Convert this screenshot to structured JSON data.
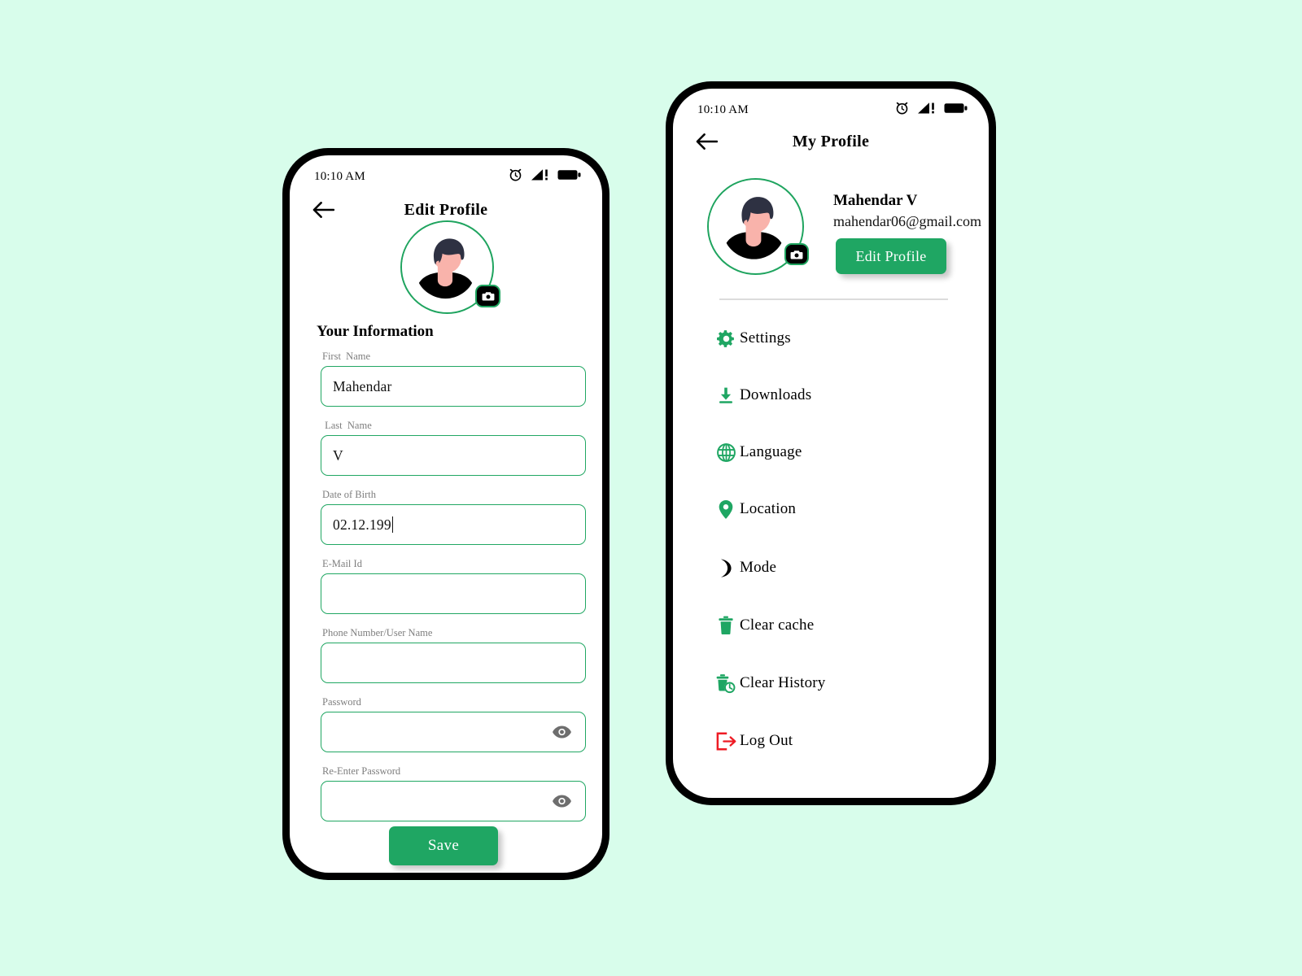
{
  "colors": {
    "page_background": "#d8fdeb",
    "accent_green": "#1fa663",
    "border_green": "#21a763",
    "logout_red": "#ee1b24",
    "label_gray": "#7e7e7e",
    "avatar_hair": "#2e3142",
    "avatar_skin": "#f9b3ab",
    "avatar_shirt": "#000000"
  },
  "edit_profile_screen": {
    "status_bar": {
      "time": "10:10 AM",
      "icons": [
        "alarm-icon",
        "signal-icon",
        "battery-icon"
      ]
    },
    "app_bar": {
      "back_icon": "arrow-left-icon",
      "title": "Edit Profile"
    },
    "avatar": {
      "name": "user-avatar",
      "camera_badge_icon": "camera-icon"
    },
    "section_title": "Your Information",
    "fields": [
      {
        "label": "First  Name",
        "value": "Mahendar",
        "placeholder": "",
        "type": "text",
        "caret": false,
        "eye": false
      },
      {
        "label": " Last  Name",
        "value": "V",
        "placeholder": "",
        "type": "text",
        "caret": false,
        "eye": false
      },
      {
        "label": "Date of Birth",
        "value": "02.12.199",
        "placeholder": "",
        "type": "text",
        "caret": true,
        "eye": false
      },
      {
        "label": "E-Mail Id",
        "value": "",
        "placeholder": "",
        "type": "email",
        "caret": false,
        "eye": false
      },
      {
        "label": "Phone Number/User Name",
        "value": "",
        "placeholder": "",
        "type": "text",
        "caret": false,
        "eye": false
      },
      {
        "label": "Password",
        "value": "",
        "placeholder": "",
        "type": "password",
        "caret": false,
        "eye": true
      },
      {
        "label": "Re-Enter Password",
        "value": "",
        "placeholder": "",
        "type": "password",
        "caret": false,
        "eye": true
      }
    ],
    "save_button": "Save"
  },
  "my_profile_screen": {
    "status_bar": {
      "time": "10:10 AM",
      "icons": [
        "alarm-icon",
        "signal-icon",
        "battery-icon"
      ]
    },
    "app_bar": {
      "back_icon": "arrow-left-icon",
      "title": "My Profile"
    },
    "avatar": {
      "name": "user-avatar",
      "camera_badge_icon": "camera-icon"
    },
    "user": {
      "name": "Mahendar V",
      "email": "mahendar06@gmail.com"
    },
    "edit_profile_button": "Edit Profile",
    "menu": [
      {
        "label": "Settings",
        "icon": "gear-icon",
        "color": "#1fa663"
      },
      {
        "label": "Downloads",
        "icon": "download-icon",
        "color": "#1fa663"
      },
      {
        "label": "Language",
        "icon": "globe-icon",
        "color": "#1fa663"
      },
      {
        "label": "Location",
        "icon": "location-pin-icon",
        "color": "#1fa663"
      },
      {
        "label": " Mode",
        "icon": "moon-icon",
        "color": "#000000"
      },
      {
        "label": "Clear cache",
        "icon": "trash-icon",
        "color": "#1fa663"
      },
      {
        "label": " Clear History",
        "icon": "trash-clock-icon",
        "color": "#1fa663"
      },
      {
        "label": "Log Out",
        "icon": "logout-arrow-icon",
        "color": "#ee1b24"
      }
    ]
  }
}
